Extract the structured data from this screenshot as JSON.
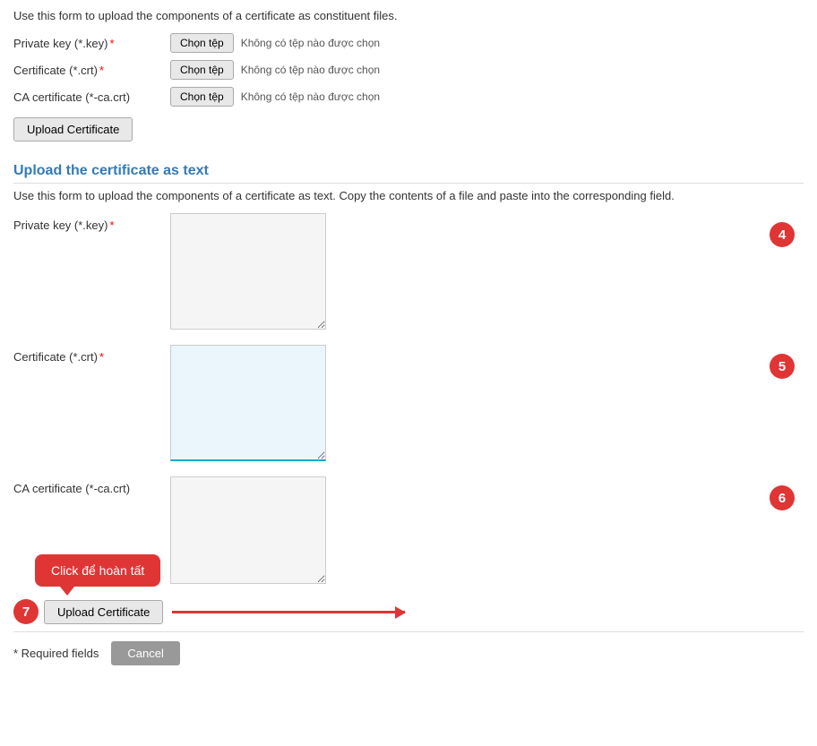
{
  "intro_files": "Use this form to upload the components of a certificate as constituent files.",
  "fields_file": [
    {
      "label": "Private key (*.key)",
      "required": true,
      "btn": "Chọn tệp",
      "no_file": "Không có tệp nào được chọn"
    },
    {
      "label": "Certificate (*.crt)",
      "required": true,
      "btn": "Chọn tệp",
      "no_file": "Không có tệp nào được chọn"
    },
    {
      "label": "CA certificate (*-ca.crt)",
      "required": false,
      "btn": "Chọn tệp",
      "no_file": "Không có tệp nào được chọn"
    }
  ],
  "upload_btn_1": "Upload Certificate",
  "section_title": "Upload the certificate as text",
  "intro_text": "Use this form to upload the components of a certificate as text. Copy the contents of a file and paste into the corresponding field.",
  "fields_text": [
    {
      "label": "Private key (*.key)",
      "required": true,
      "badge": "4",
      "active": false
    },
    {
      "label": "Certificate (*.crt)",
      "required": true,
      "badge": "5",
      "active": true
    },
    {
      "label": "CA certificate (*-ca.crt)",
      "required": false,
      "badge": "6",
      "active": false
    }
  ],
  "tooltip_text": "Click để hoàn tất",
  "badge_7": "7",
  "upload_btn_2": "Upload Certificate",
  "required_note": "* Required fields",
  "cancel_btn": "Cancel",
  "arrow_label": "←"
}
